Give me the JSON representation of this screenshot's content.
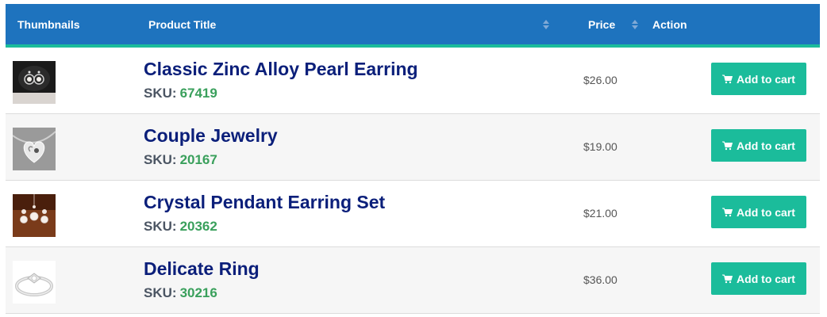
{
  "table": {
    "headers": {
      "thumbnails": "Thumbnails",
      "product_title": "Product Title",
      "price": "Price",
      "action": "Action"
    },
    "colors": {
      "header_bg": "#1e73be",
      "accent": "#1bbc9b",
      "title_text": "#0b1f7a",
      "sku_value": "#3aa05c"
    },
    "rows": [
      {
        "title": "Classic Zinc Alloy Pearl Earring",
        "sku_label": "SKU:",
        "sku": "67419",
        "price": "$26.00",
        "button": "Add to cart",
        "thumb": "pearl-earring-photo"
      },
      {
        "title": "Couple Jewelry",
        "sku_label": "SKU:",
        "sku": "20167",
        "price": "$19.00",
        "button": "Add to cart",
        "thumb": "heart-pendant-photo"
      },
      {
        "title": "Crystal Pendant Earring Set",
        "sku_label": "SKU:",
        "sku": "20362",
        "price": "$21.00",
        "button": "Add to cart",
        "thumb": "crystal-set-photo"
      },
      {
        "title": "Delicate Ring",
        "sku_label": "SKU:",
        "sku": "30216",
        "price": "$36.00",
        "button": "Add to cart",
        "thumb": "ring-photo"
      }
    ]
  }
}
